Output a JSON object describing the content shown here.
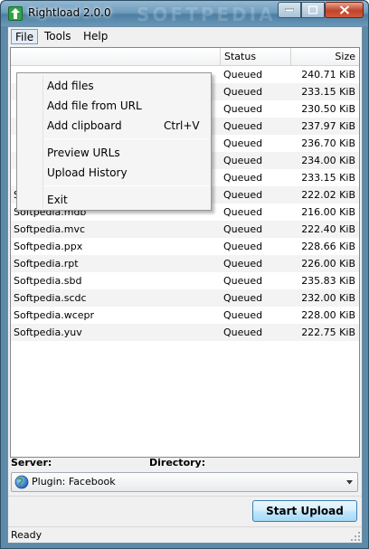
{
  "window": {
    "title": "Rightload 2.0.0",
    "watermark": "SOFTPEDIA"
  },
  "menubar": {
    "file": "File",
    "tools": "Tools",
    "help": "Help"
  },
  "file_menu": {
    "add_files": "Add files",
    "add_file_url": "Add file from URL",
    "add_clipboard": "Add clipboard",
    "add_clipboard_shortcut": "Ctrl+V",
    "preview_urls": "Preview URLs",
    "upload_history": "Upload History",
    "exit": "Exit"
  },
  "list": {
    "columns": {
      "name": "",
      "status": "Status",
      "size": "Size"
    },
    "rows": [
      {
        "name": "",
        "status": "Queued",
        "size": "240.71 KiB"
      },
      {
        "name": "",
        "status": "Queued",
        "size": "233.15 KiB"
      },
      {
        "name": "",
        "status": "Queued",
        "size": "230.50 KiB"
      },
      {
        "name": "",
        "status": "Queued",
        "size": "237.97 KiB"
      },
      {
        "name": "",
        "status": "Queued",
        "size": "236.70 KiB"
      },
      {
        "name": "",
        "status": "Queued",
        "size": "234.00 KiB"
      },
      {
        "name": "",
        "status": "Queued",
        "size": "233.15 KiB"
      },
      {
        "name": "Softpedia.ebc",
        "status": "Queued",
        "size": "222.02 KiB"
      },
      {
        "name": "Softpedia.mdb",
        "status": "Queued",
        "size": "216.00 KiB"
      },
      {
        "name": "Softpedia.mvc",
        "status": "Queued",
        "size": "222.40 KiB"
      },
      {
        "name": "Softpedia.ppx",
        "status": "Queued",
        "size": "228.66 KiB"
      },
      {
        "name": "Softpedia.rpt",
        "status": "Queued",
        "size": "226.00 KiB"
      },
      {
        "name": "Softpedia.sbd",
        "status": "Queued",
        "size": "235.83 KiB"
      },
      {
        "name": "Softpedia.scdc",
        "status": "Queued",
        "size": "232.00 KiB"
      },
      {
        "name": "Softpedia.wcepr",
        "status": "Queued",
        "size": "228.00 KiB"
      },
      {
        "name": "Softpedia.yuv",
        "status": "Queued",
        "size": "222.75 KiB"
      }
    ]
  },
  "bottom": {
    "server_label": "Server:",
    "directory_label": "Directory:",
    "plugin_value": "Plugin: Facebook",
    "start_upload": "Start Upload",
    "status": "Ready"
  },
  "colors": {
    "titlebar": "#6f9cbd",
    "close_button": "#c0432a",
    "app_icon": "#2fa344",
    "start_button": "#bee6fd"
  },
  "icons": {
    "app": "upload-arrow-icon",
    "plugin": "globe-icon",
    "combo_arrow": "chevron-down-icon"
  }
}
